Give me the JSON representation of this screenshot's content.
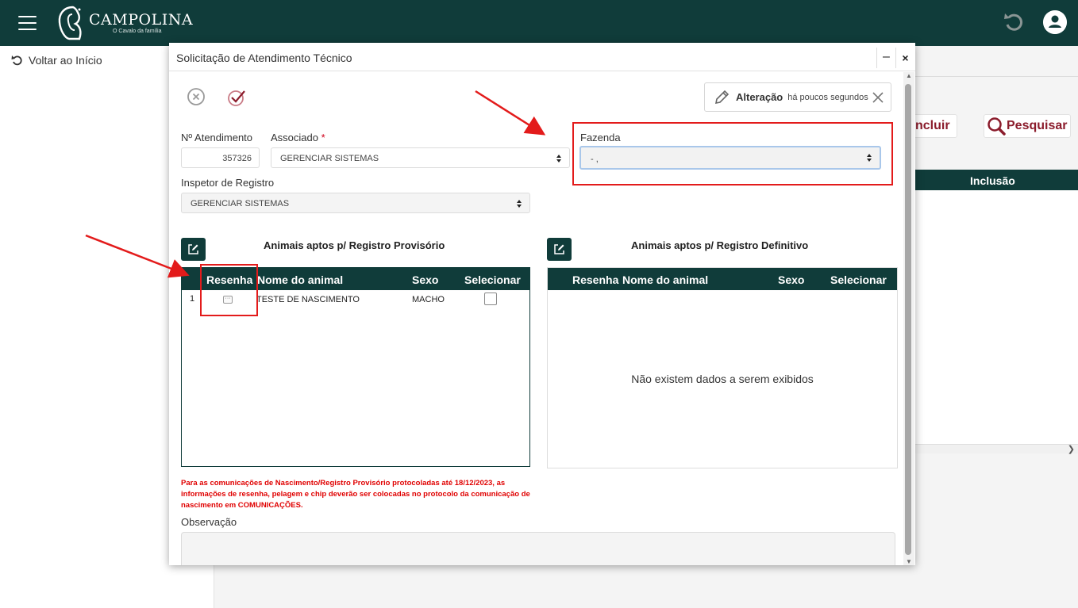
{
  "brand": {
    "name": "CAMPOLINA",
    "tagline": "O Cavalo da família"
  },
  "sidebar": {
    "back_label": "Voltar ao Início"
  },
  "background": {
    "incluir_label": "ncluir",
    "pesquisar_label": "Pesquisar",
    "col_inclusao": "Inclusão"
  },
  "modal": {
    "title": "Solicitação de Atendimento Técnico",
    "minimize": "–",
    "close": "×",
    "audit": {
      "label": "Alteração",
      "time": "há poucos segundos"
    },
    "fields": {
      "atendimento_label": "Nº Atendimento",
      "atendimento_value": "357326",
      "associado_label": "Associado",
      "required_mark": "*",
      "associado_value": "GERENCIAR SISTEMAS",
      "fazenda_label": "Fazenda",
      "fazenda_value": "- ,",
      "inspetor_label": "Inspetor de Registro",
      "inspetor_value": "GERENCIAR SISTEMAS"
    },
    "grid_provisorio": {
      "title": "Animais aptos p/ Registro Provisório",
      "columns": [
        "Resenha",
        "Nome do animal",
        "Sexo",
        "Selecionar"
      ],
      "rows": [
        {
          "num": "1",
          "resenha": "···",
          "nome": "TESTE DE NASCIMENTO",
          "sexo": "MACHO",
          "selecionado": false
        }
      ]
    },
    "grid_definitivo": {
      "title": "Animais aptos p/ Registro Definitivo",
      "columns": [
        "Resenha",
        "Nome do animal",
        "Sexo",
        "Selecionar"
      ],
      "empty_message": "Não existem dados a serem exibidos"
    },
    "warning": "Para as comunicações de Nascimento/Registro Provisório protocoladas até 18/12/2023, as informações de resenha, pelagem e chip deverão ser colocadas no protocolo da comunicação de nascimento em COMUNICAÇÕES.",
    "observacao_label": "Observação"
  },
  "colors": {
    "header": "#103c3a",
    "accent": "#8b1c2c",
    "annotation": "#e31b1b",
    "warning": "#e00000"
  }
}
